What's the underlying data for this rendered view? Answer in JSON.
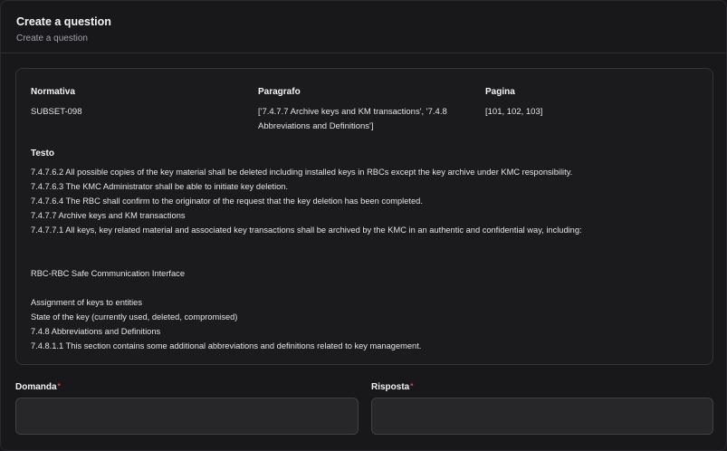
{
  "header": {
    "title": "Create a question",
    "subtitle": "Create a question"
  },
  "info": {
    "columns": [
      {
        "label": "Normativa",
        "value": "SUBSET-098"
      },
      {
        "label": "Paragrafo",
        "value_lines": [
          "['7.4.7.7 Archive keys and KM transactions', '7.4.8",
          "Abbreviations and Definitions']"
        ]
      },
      {
        "label": "Pagina",
        "value": "[101, 102, 103]"
      }
    ],
    "testo_label": "Testo",
    "testo_lines": [
      "7.4.7.6.2 All possible copies of the key material shall be deleted including installed keys in RBCs except the key archive under KMC responsibility.",
      "7.4.7.6.3 The KMC Administrator shall be able to initiate key deletion.",
      "7.4.7.6.4 The RBC shall confirm to the originator of the request that the key deletion has been completed.",
      "7.4.7.7 Archive keys and KM transactions",
      "7.4.7.7.1 All keys, key related material and associated key transactions shall be archived by the KMC in an authentic and confidential way, including:",
      "",
      "",
      "RBC-RBC Safe Communication Interface",
      "",
      "Assignment of keys to entities",
      "State of the key (currently used, deleted, compromised)",
      "7.4.8 Abbreviations and Definitions",
      "7.4.8.1.1 This section contains some additional abbreviations and definitions related to key management."
    ]
  },
  "form": {
    "domanda_label": "Domanda",
    "domanda_value": "",
    "risposta_label": "Risposta",
    "risposta_value": "",
    "required_mark": "*"
  },
  "colors": {
    "background": "#18181b",
    "required": "#ef4444",
    "input_bg": "#27272a"
  }
}
